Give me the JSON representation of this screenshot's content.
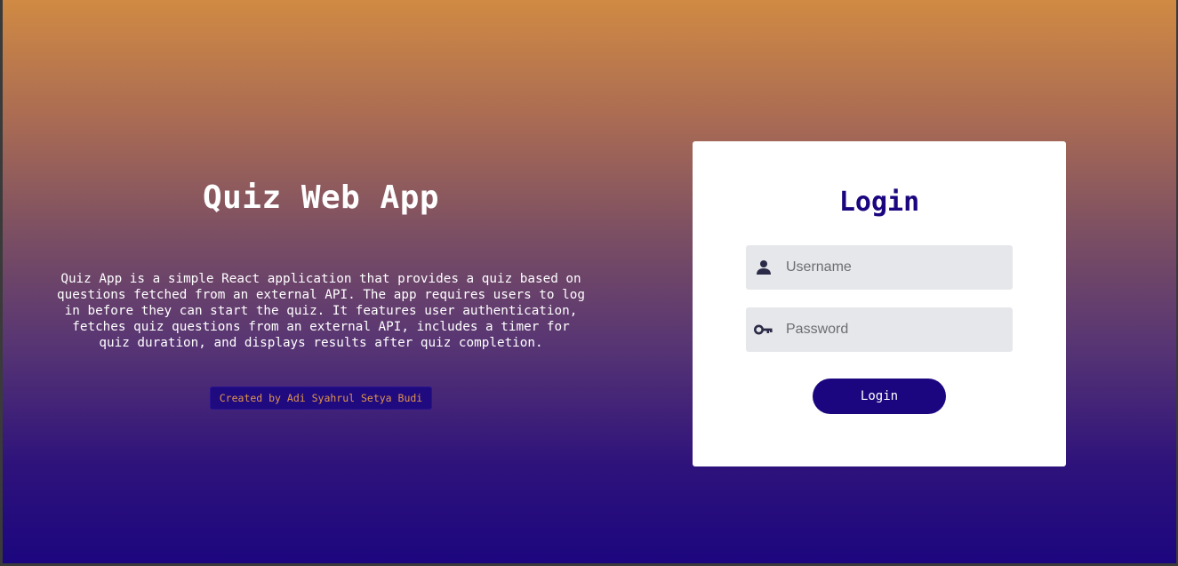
{
  "intro": {
    "title": "Quiz Web App",
    "description": "Quiz App is a simple React application that provides a quiz based on questions fetched from an external API. The app requires users to log in before they can start the quiz. It features user authentication, fetches quiz questions from an external API, includes a timer for quiz duration, and displays results after quiz completion.",
    "credit": "Created by Adi Syahrul Setya Budi"
  },
  "login": {
    "title": "Login",
    "username": {
      "placeholder": "Username",
      "value": "",
      "icon": "user-icon"
    },
    "password": {
      "placeholder": "Password",
      "value": "",
      "icon": "key-icon"
    },
    "button_label": "Login"
  },
  "colors": {
    "gradient_top": "#d08a43",
    "gradient_bottom": "#1c067f",
    "accent": "#1c067f",
    "credit_text": "#e0944c",
    "field_bg": "#e6e7ea"
  }
}
